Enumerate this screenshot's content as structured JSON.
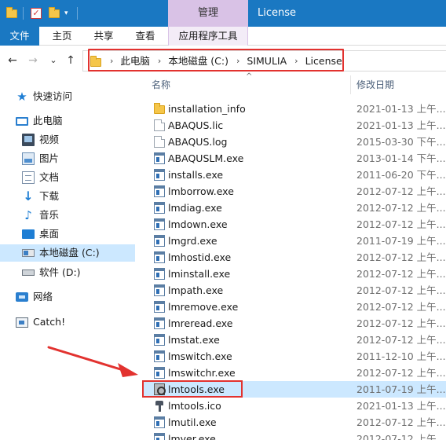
{
  "titlebar": {
    "manage_tab": "管理",
    "window_title": "License"
  },
  "ribbon": {
    "tabs": [
      "文件",
      "主页",
      "共享",
      "查看",
      "应用程序工具"
    ]
  },
  "nav": {
    "back": "←",
    "forward": "→",
    "recent": "⌄",
    "up": "↑"
  },
  "address": {
    "crumbs": [
      "此电脑",
      "本地磁盘 (C:)",
      "SIMULIA",
      "License"
    ]
  },
  "sidebar": {
    "items": [
      {
        "label": "快速访问",
        "icon": "star-icon"
      },
      {
        "label": "此电脑",
        "icon": "computer-icon"
      },
      {
        "label": "视频",
        "icon": "video-icon"
      },
      {
        "label": "图片",
        "icon": "pictures-icon"
      },
      {
        "label": "文档",
        "icon": "documents-icon"
      },
      {
        "label": "下载",
        "icon": "download-icon"
      },
      {
        "label": "音乐",
        "icon": "music-icon"
      },
      {
        "label": "桌面",
        "icon": "desktop-icon"
      },
      {
        "label": "本地磁盘 (C:)",
        "icon": "drive-c-icon"
      },
      {
        "label": "软件 (D:)",
        "icon": "drive-d-icon"
      },
      {
        "label": "网络",
        "icon": "network-icon"
      },
      {
        "label": "Catch!",
        "icon": "catch-icon"
      }
    ]
  },
  "list": {
    "col_name": "名称",
    "col_date": "修改日期",
    "files": [
      {
        "name": "installation_info",
        "date": "2021-01-13 上午...",
        "icon": "folder-icon"
      },
      {
        "name": "ABAQUS.lic",
        "date": "2021-01-13 上午...",
        "icon": "file-icon"
      },
      {
        "name": "ABAQUS.log",
        "date": "2015-03-30 下午...",
        "icon": "file-icon"
      },
      {
        "name": "ABAQUSLM.exe",
        "date": "2013-01-14 下午...",
        "icon": "exe-icon"
      },
      {
        "name": "installs.exe",
        "date": "2011-06-20 下午...",
        "icon": "exe-icon"
      },
      {
        "name": "lmborrow.exe",
        "date": "2012-07-12 上午...",
        "icon": "exe-icon"
      },
      {
        "name": "lmdiag.exe",
        "date": "2012-07-12 上午...",
        "icon": "exe-icon"
      },
      {
        "name": "lmdown.exe",
        "date": "2012-07-12 上午...",
        "icon": "exe-icon"
      },
      {
        "name": "lmgrd.exe",
        "date": "2011-07-19 上午...",
        "icon": "exe-icon"
      },
      {
        "name": "lmhostid.exe",
        "date": "2012-07-12 上午...",
        "icon": "exe-icon"
      },
      {
        "name": "lminstall.exe",
        "date": "2012-07-12 上午...",
        "icon": "exe-icon"
      },
      {
        "name": "lmpath.exe",
        "date": "2012-07-12 上午...",
        "icon": "exe-icon"
      },
      {
        "name": "lmremove.exe",
        "date": "2012-07-12 上午...",
        "icon": "exe-icon"
      },
      {
        "name": "lmreread.exe",
        "date": "2012-07-12 上午...",
        "icon": "exe-icon"
      },
      {
        "name": "lmstat.exe",
        "date": "2012-07-12 上午...",
        "icon": "exe-icon"
      },
      {
        "name": "lmswitch.exe",
        "date": "2011-12-10 上午...",
        "icon": "exe-icon"
      },
      {
        "name": "lmswitchr.exe",
        "date": "2012-07-12 上午...",
        "icon": "exe-icon"
      },
      {
        "name": "lmtools.exe",
        "date": "2011-07-19 上午...",
        "icon": "lmtools-icon"
      },
      {
        "name": "lmtools.ico",
        "date": "2021-01-13 上午...",
        "icon": "ico-file-icon"
      },
      {
        "name": "lmutil.exe",
        "date": "2012-07-12 上午...",
        "icon": "exe-icon"
      },
      {
        "name": "lmver.exe",
        "date": "2012-07-12 上午...",
        "icon": "exe-icon"
      }
    ]
  },
  "colors": {
    "titlebar": "#1a78c2",
    "manage": "#d9c2e6",
    "selection": "#cce8ff",
    "highlight_red": "#e2322f"
  }
}
